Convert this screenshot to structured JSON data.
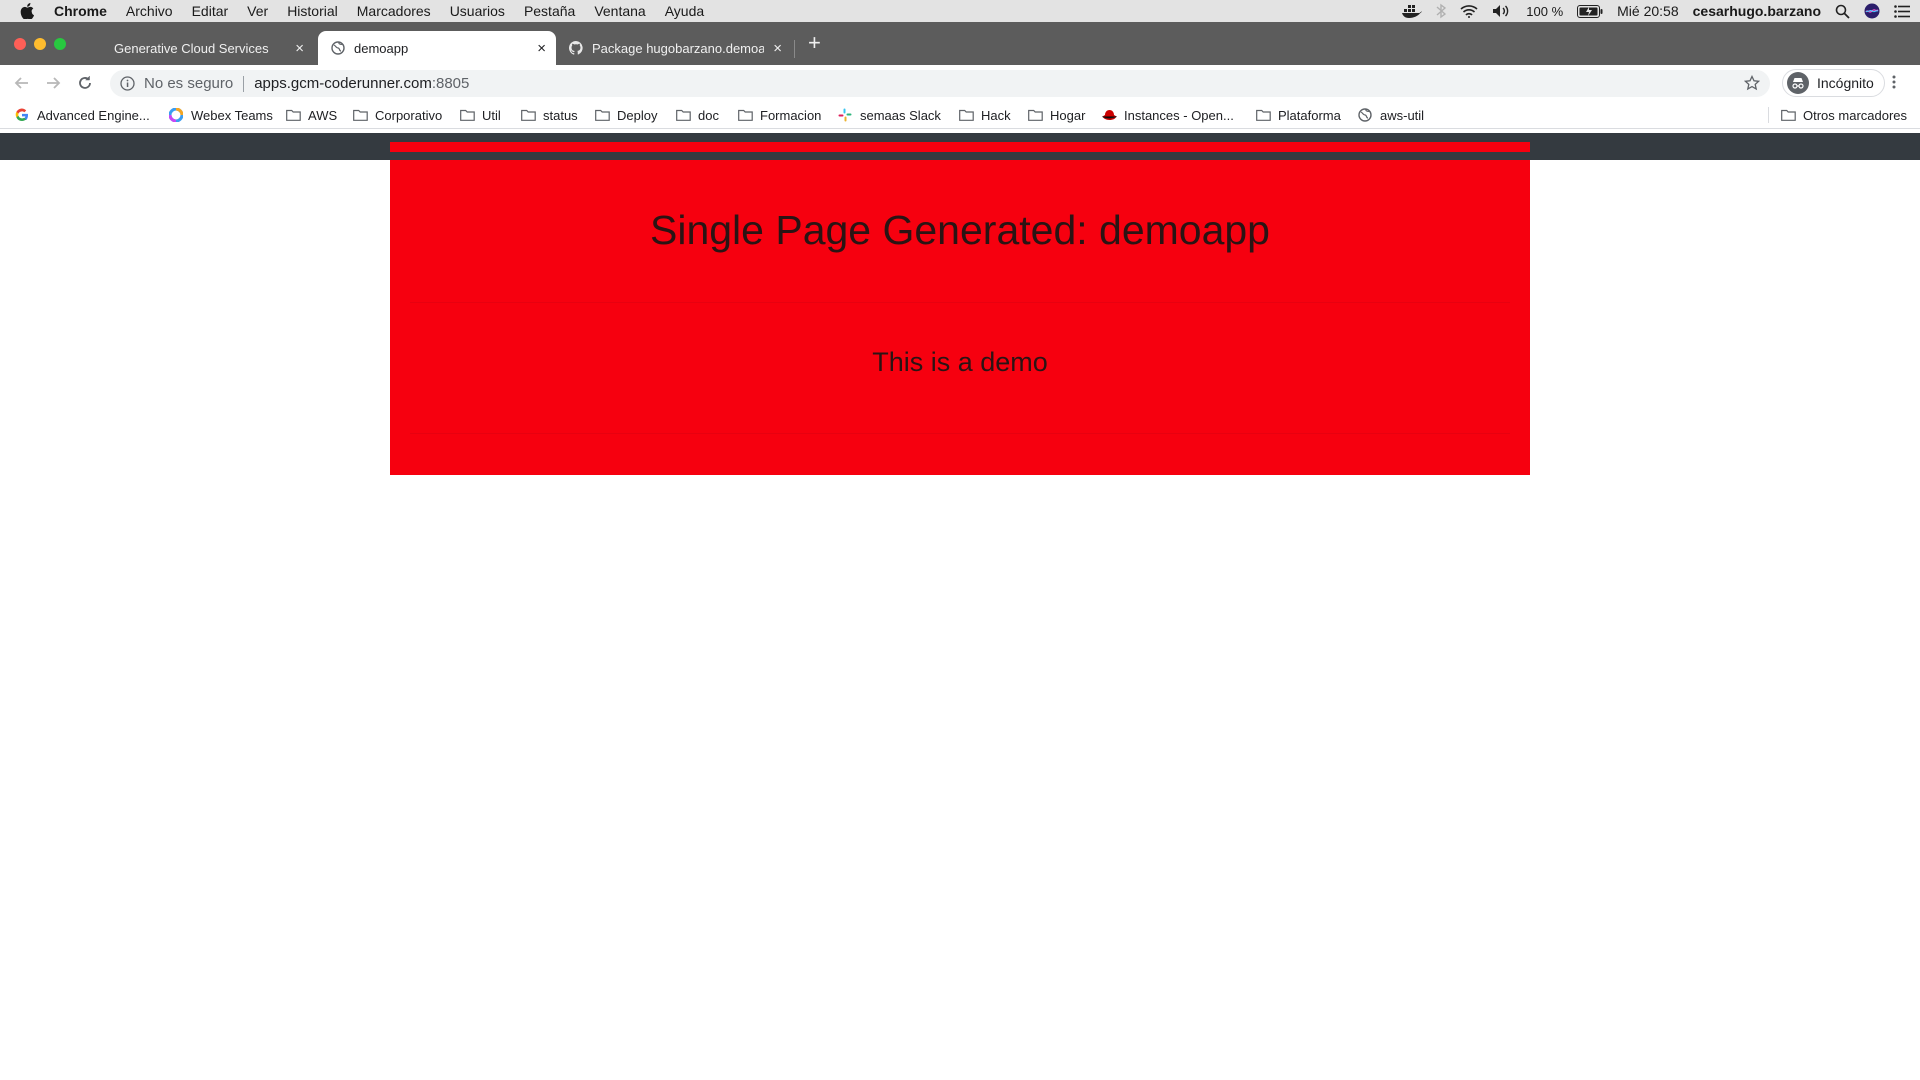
{
  "menubar": {
    "app_name": "Chrome",
    "items": [
      "Archivo",
      "Editar",
      "Ver",
      "Historial",
      "Marcadores",
      "Usuarios",
      "Pestaña",
      "Ventana",
      "Ayuda"
    ],
    "battery": "100 %",
    "clock": "Mié 20:58",
    "user": "cesarhugo.barzano"
  },
  "tabs": [
    {
      "title": "Generative Cloud Services",
      "close": "×"
    },
    {
      "title": "demoapp",
      "close": "×"
    },
    {
      "title": "Package hugobarzano.demoapp",
      "close": "×"
    }
  ],
  "new_tab": "+",
  "omnibox": {
    "security": "No es seguro",
    "host": "apps.gcm-coderunner.com",
    "port": ":8805"
  },
  "incognito_label": "Incógnito",
  "bookmarks": [
    {
      "label": "Advanced Engine...",
      "icon": "google-icon"
    },
    {
      "label": "Webex Teams",
      "icon": "webex-icon"
    },
    {
      "label": "AWS",
      "icon": "folder-icon"
    },
    {
      "label": "Corporativo",
      "icon": "folder-icon"
    },
    {
      "label": "Util",
      "icon": "folder-icon"
    },
    {
      "label": "status",
      "icon": "folder-icon"
    },
    {
      "label": "Deploy",
      "icon": "folder-icon"
    },
    {
      "label": "doc",
      "icon": "folder-icon"
    },
    {
      "label": "Formacion",
      "icon": "folder-icon"
    },
    {
      "label": "semaas Slack",
      "icon": "slack-icon"
    },
    {
      "label": "Hack",
      "icon": "folder-icon"
    },
    {
      "label": "Hogar",
      "icon": "folder-icon"
    },
    {
      "label": "Instances - Open...",
      "icon": "redhat-icon"
    },
    {
      "label": "Plataforma",
      "icon": "folder-icon"
    },
    {
      "label": "aws-util",
      "icon": "globe-icon"
    }
  ],
  "other_bookmarks": "Otros marcadores",
  "page": {
    "heading": "Single Page Generated: demoapp",
    "lead": "This is a demo"
  },
  "colors": {
    "accent_red": "#f6000f",
    "navbar_dark": "#343a40",
    "tabstrip": "#5c5c5c"
  }
}
